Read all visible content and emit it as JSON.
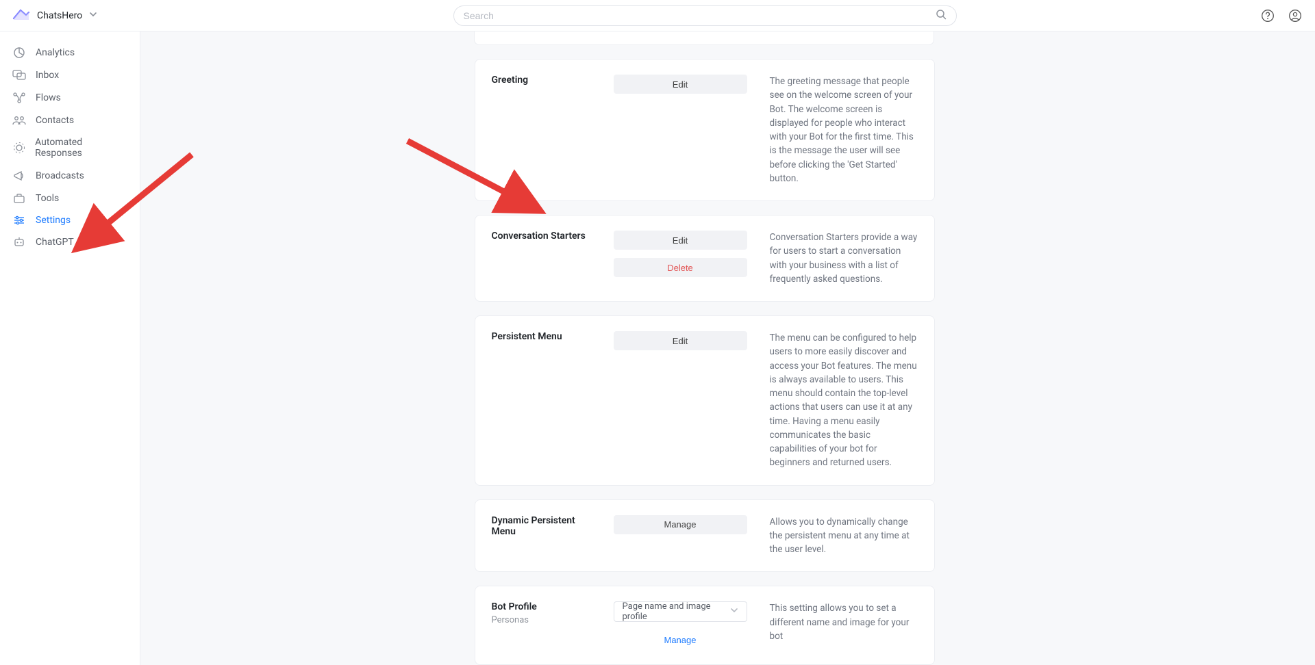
{
  "brand": {
    "name": "ChatsHero"
  },
  "search": {
    "placeholder": "Search"
  },
  "sidebar": {
    "items": [
      {
        "icon": "analytics",
        "label": "Analytics"
      },
      {
        "icon": "inbox",
        "label": "Inbox"
      },
      {
        "icon": "flows",
        "label": "Flows"
      },
      {
        "icon": "contacts",
        "label": "Contacts"
      },
      {
        "icon": "automated",
        "label": "Automated Responses"
      },
      {
        "icon": "broadcasts",
        "label": "Broadcasts"
      },
      {
        "icon": "tools",
        "label": "Tools"
      },
      {
        "icon": "settings",
        "label": "Settings",
        "active": true
      },
      {
        "icon": "chatgpt",
        "label": "ChatGPT"
      }
    ]
  },
  "sections": {
    "greeting": {
      "title": "Greeting",
      "edit": "Edit",
      "desc": "The greeting message that people see on the welcome screen of your Bot. The welcome screen is displayed for people who interact with your Bot for the first time. This is the message the user will see before clicking the 'Get Started' button."
    },
    "conversation_starters": {
      "title": "Conversation Starters",
      "edit": "Edit",
      "delete": "Delete",
      "desc": "Conversation Starters provide a way for users to start a conversation with your business with a list of frequently asked questions."
    },
    "persistent_menu": {
      "title": "Persistent Menu",
      "edit": "Edit",
      "desc": "The menu can be configured to help users to more easily discover and access your Bot features. The menu is always available to users. This menu should contain the top-level actions that users can use it at any time. Having a menu easily communicates the basic capabilities of your bot for beginners and returned users."
    },
    "dynamic_persistent_menu": {
      "title": "Dynamic Persistent Menu",
      "manage": "Manage",
      "desc": "Allows you to dynamically change the persistent menu at any time at the user level."
    },
    "bot_profile": {
      "title": "Bot Profile",
      "subtitle": "Personas",
      "select_value": "Page name and image profile",
      "manage": "Manage",
      "desc": "This setting allows you to set a different name and image for your bot"
    }
  }
}
